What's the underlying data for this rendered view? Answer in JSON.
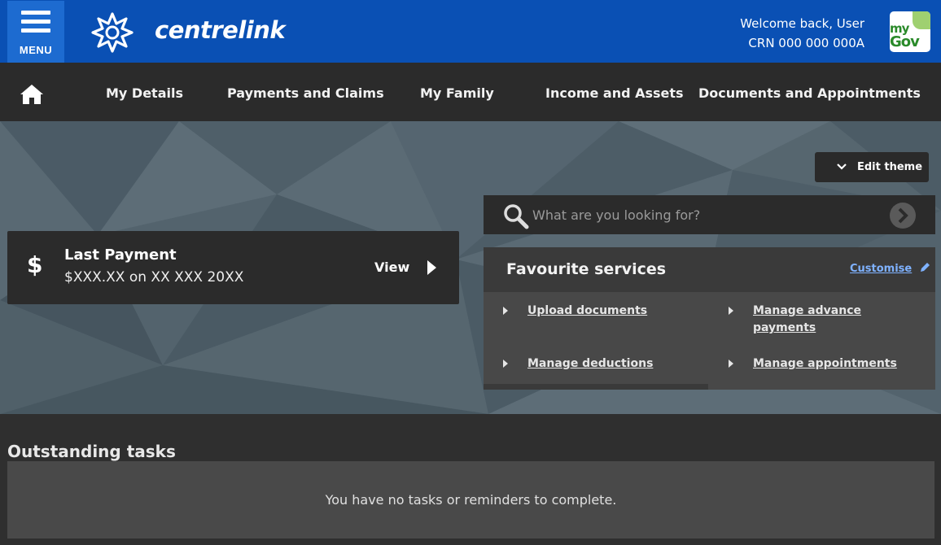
{
  "header": {
    "menu_label": "MENU",
    "brand": "centrelink",
    "welcome": "Welcome back, User",
    "crn": "CRN 000 000 000A",
    "mygov_line1": "my",
    "mygov_line2": "Gov",
    "bg_color": "#0a50b4"
  },
  "nav": {
    "items": [
      {
        "label": "My Details"
      },
      {
        "label": "Payments and Claims"
      },
      {
        "label": "My Family"
      },
      {
        "label": "Income and Assets"
      },
      {
        "label": "Documents and Appointments"
      }
    ]
  },
  "theme": {
    "edit_label": "Edit theme"
  },
  "search": {
    "placeholder": "What are you looking for?"
  },
  "last_payment": {
    "symbol": "$",
    "title": "Last Payment",
    "amount": "$XXX.XX on XX XXX 20XX",
    "view_label": "View"
  },
  "favourites": {
    "title": "Favourite services",
    "customise_label": "Customise",
    "links": [
      {
        "label": "Upload documents"
      },
      {
        "label": "Manage advance payments"
      },
      {
        "label": "Manage deductions"
      },
      {
        "label": "Manage appointments"
      }
    ]
  },
  "tasks": {
    "title": "Outstanding tasks",
    "message": "You have no tasks or reminders to complete."
  }
}
